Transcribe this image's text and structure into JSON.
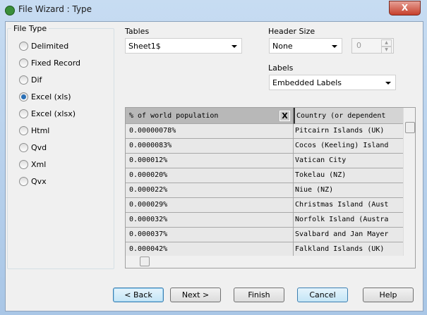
{
  "window": {
    "title": "File Wizard : Type",
    "close_label": "X"
  },
  "file_type": {
    "label": "File Type",
    "selected": "Excel (xls)",
    "options": [
      "Delimited",
      "Fixed Record",
      "Dif",
      "Excel (xls)",
      "Excel (xlsx)",
      "Html",
      "Qvd",
      "Xml",
      "Qvx"
    ]
  },
  "tables": {
    "label": "Tables",
    "value": "Sheet1$"
  },
  "header_size": {
    "label": "Header Size",
    "value": "None",
    "number": "0"
  },
  "labels": {
    "label": "Labels",
    "value": "Embedded Labels"
  },
  "grid": {
    "columns": [
      "% of world population",
      "Country (or dependent"
    ],
    "close_label": "X",
    "rows": [
      [
        "0.00000078%",
        "Pitcairn Islands (UK)"
      ],
      [
        "0.0000083%",
        "Cocos (Keeling) Island"
      ],
      [
        "0.000012%",
        "Vatican City"
      ],
      [
        "0.000020%",
        "Tokelau (NZ)"
      ],
      [
        "0.000022%",
        "Niue (NZ)"
      ],
      [
        "0.000029%",
        "Christmas Island (Aust"
      ],
      [
        "0.000032%",
        "Norfolk Island (Austra"
      ],
      [
        "0.000037%",
        "Svalbard and Jan Mayer"
      ],
      [
        "0.000042%",
        "Falkland Islands (UK)"
      ]
    ]
  },
  "buttons": {
    "back": "< Back",
    "next": "Next >",
    "finish": "Finish",
    "cancel": "Cancel",
    "help": "Help"
  }
}
